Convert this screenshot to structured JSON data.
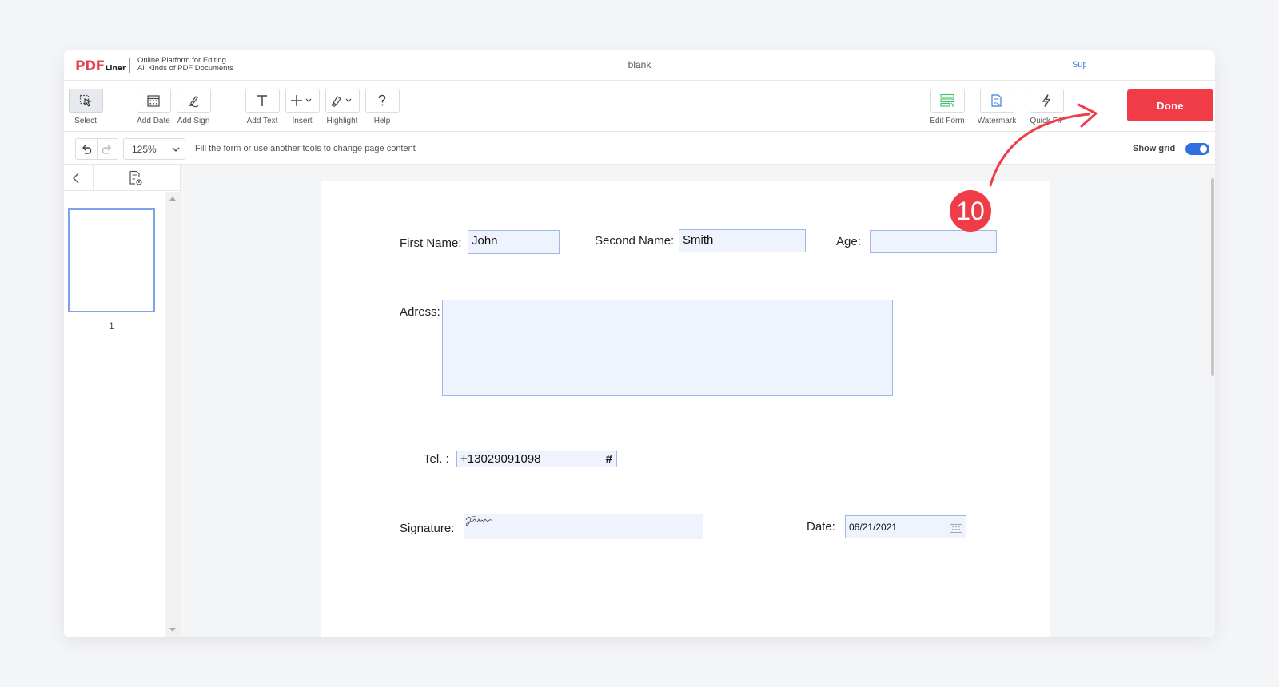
{
  "header": {
    "logo_main": "PDF",
    "logo_sub": "Liner",
    "tagline_line1": "Online Platform for Editing",
    "tagline_line2": "All Kinds of PDF Documents",
    "doc_title": "blank",
    "support_link": "Support"
  },
  "toolbar": {
    "tools": [
      {
        "label": "Select",
        "icon": "cursor-icon"
      },
      {
        "label": "Add Date",
        "icon": "calendar-icon"
      },
      {
        "label": "Add Sign",
        "icon": "pen-icon"
      },
      {
        "label": "Add Text",
        "icon": "text-icon"
      },
      {
        "label": "Insert",
        "icon": "plus-icon"
      },
      {
        "label": "Highlight",
        "icon": "highlighter-icon"
      },
      {
        "label": "Help",
        "icon": "question-icon"
      },
      {
        "label": "Edit Form",
        "icon": "form-icon"
      },
      {
        "label": "Watermark",
        "icon": "watermark-icon"
      },
      {
        "label": "Quick Fill",
        "icon": "lightning-icon"
      }
    ],
    "done_label": "Done"
  },
  "subbar": {
    "zoom": "125%",
    "hint": "Fill the form or use another tools to change page content",
    "show_grid_label": "Show grid",
    "show_grid_on": true
  },
  "sidebar": {
    "page_number": "1"
  },
  "form": {
    "first_name_label": "First Name:",
    "first_name_value": "John",
    "second_name_label": "Second Name:",
    "second_name_value": "Smith",
    "age_label": "Age:",
    "age_value": "",
    "address_label": "Adress:",
    "address_value": "",
    "tel_label": "Tel. :",
    "tel_value": "+13029091098",
    "tel_icon": "#",
    "signature_label": "Signature:",
    "date_label": "Date:",
    "date_value": "06/21/2021"
  },
  "annotation": {
    "step_number": "10",
    "color": "#ef3c47"
  }
}
